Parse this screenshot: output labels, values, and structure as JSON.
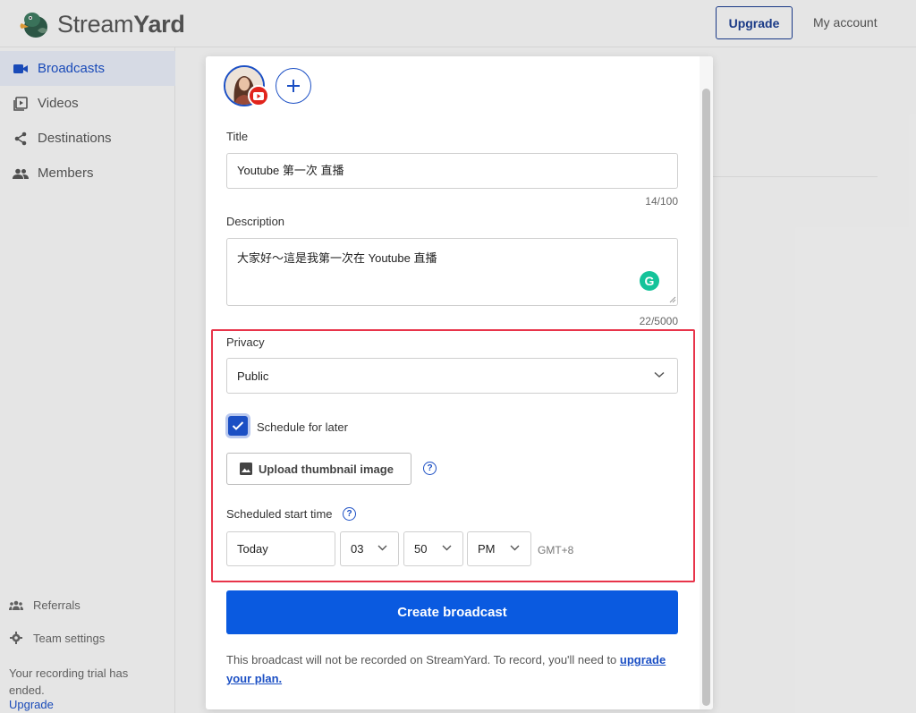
{
  "header": {
    "brand_light": "Stream",
    "brand_bold": "Yard",
    "upgrade_label": "Upgrade",
    "account_label": "My account"
  },
  "sidebar": {
    "items": [
      {
        "label": "Broadcasts",
        "icon": "video-camera-icon",
        "active": true
      },
      {
        "label": "Videos",
        "icon": "video-library-icon",
        "active": false
      },
      {
        "label": "Destinations",
        "icon": "share-icon",
        "active": false
      },
      {
        "label": "Members",
        "icon": "people-icon",
        "active": false
      }
    ],
    "bottom": [
      {
        "label": "Referrals",
        "icon": "group-icon"
      },
      {
        "label": "Team settings",
        "icon": "gear-icon"
      }
    ],
    "trial_text": "Your recording trial has ended.",
    "trial_link": "Upgrade"
  },
  "modal": {
    "title_label": "Title",
    "title_value": "Youtube 第一次 直播",
    "title_counter": "14/100",
    "description_label": "Description",
    "description_value": "大家好～這是我第一次在 Youtube 直播",
    "description_counter": "22/5000",
    "privacy_label": "Privacy",
    "privacy_value": "Public",
    "schedule_label": "Schedule for later",
    "schedule_checked": true,
    "upload_label": "Upload thumbnail image",
    "scheduled_label": "Scheduled start time",
    "day_value": "Today",
    "hour_value": "03",
    "minute_value": "50",
    "ampm_value": "PM",
    "timezone": "GMT+8",
    "create_label": "Create broadcast",
    "note_text": "This broadcast will not be recorded on StreamYard. To record, you'll need to",
    "note_link": "upgrade your plan."
  },
  "colors": {
    "accent": "#0a5ae0",
    "highlight": "#e8344a",
    "youtube": "#e1241c",
    "grammarly": "#15c39a"
  }
}
